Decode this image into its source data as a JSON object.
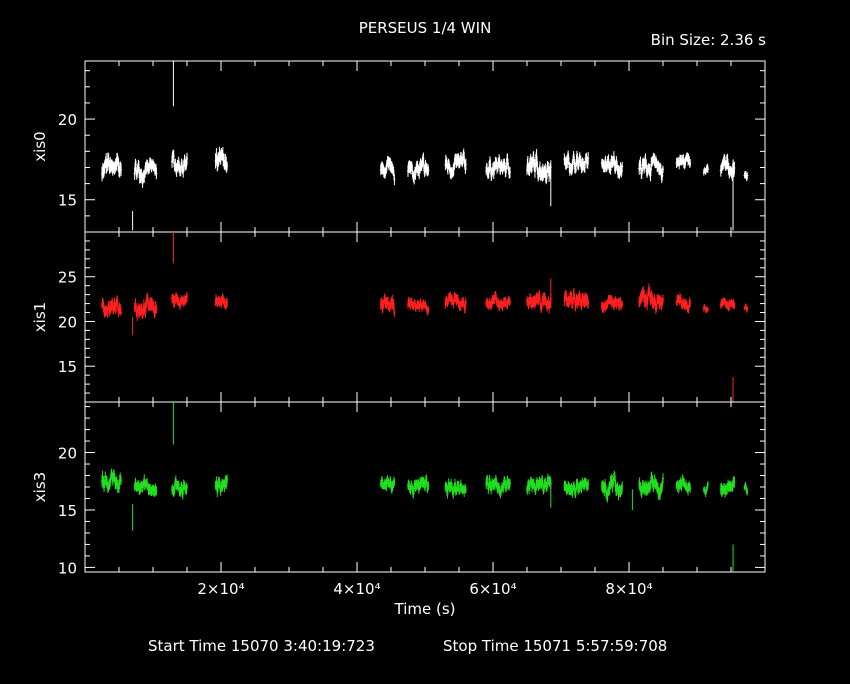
{
  "title": "PERSEUS 1/4 WIN",
  "bin_size_label": "Bin Size: 2.36 s",
  "xlabel": "Time (s)",
  "footer": {
    "start_label": "Start Time 15070  3:40:19:723",
    "stop_label": "Stop Time 15071  5:57:59:708"
  },
  "x_axis": {
    "range": [
      0,
      100000
    ],
    "ticks": [
      {
        "value": 20000,
        "label": "2×10⁴"
      },
      {
        "value": 40000,
        "label": "4×10⁴"
      },
      {
        "value": 60000,
        "label": "6×10⁴"
      },
      {
        "value": 80000,
        "label": "8×10⁴"
      }
    ],
    "minor_step": 5000
  },
  "chart_data": [
    {
      "type": "scatter",
      "name": "xis0",
      "ylabel": "xis0",
      "color": "#ffffff",
      "ylim": [
        13,
        23.6
      ],
      "yticks": [
        15,
        20
      ],
      "segments": [
        {
          "x0": 2500,
          "x1": 5300,
          "base": 16.9,
          "amp": 0.6
        },
        {
          "x0": 7300,
          "x1": 10500,
          "base": 16.8,
          "amp": 0.5
        },
        {
          "x0": 12800,
          "x1": 15000,
          "base": 17.2,
          "amp": 0.5
        },
        {
          "x0": 19200,
          "x1": 20900,
          "base": 17.2,
          "amp": 0.6
        },
        {
          "x0": 43500,
          "x1": 45500,
          "base": 16.7,
          "amp": 0.5
        },
        {
          "x0": 47500,
          "x1": 50500,
          "base": 16.8,
          "amp": 0.5
        },
        {
          "x0": 53000,
          "x1": 56000,
          "base": 17.1,
          "amp": 0.5
        },
        {
          "x0": 59000,
          "x1": 62500,
          "base": 17.0,
          "amp": 0.5
        },
        {
          "x0": 65000,
          "x1": 68500,
          "base": 17.0,
          "amp": 0.6
        },
        {
          "x0": 70500,
          "x1": 74000,
          "base": 17.3,
          "amp": 0.5
        },
        {
          "x0": 76000,
          "x1": 79000,
          "base": 17.1,
          "amp": 0.5
        },
        {
          "x0": 81500,
          "x1": 85000,
          "base": 17.0,
          "amp": 0.5
        },
        {
          "x0": 87000,
          "x1": 89000,
          "base": 17.3,
          "amp": 0.4
        },
        {
          "x0": 91000,
          "x1": 91600,
          "base": 16.8,
          "amp": 0.3
        },
        {
          "x0": 93500,
          "x1": 95500,
          "base": 17.0,
          "amp": 0.5
        },
        {
          "x0": 97000,
          "x1": 97400,
          "base": 16.6,
          "amp": 0.3
        }
      ],
      "spikes": [
        {
          "x": 13000,
          "y0": 20.8,
          "y1": 23.6
        },
        {
          "x": 7000,
          "y0": 13.1,
          "y1": 14.3
        },
        {
          "x": 95300,
          "y0": 13.1,
          "y1": 16.8
        },
        {
          "x": 68500,
          "y0": 14.6,
          "y1": 16.6
        }
      ]
    },
    {
      "type": "scatter",
      "name": "xis1",
      "ylabel": "xis1",
      "color": "#ff2020",
      "ylim": [
        11,
        30
      ],
      "yticks": [
        15,
        20,
        25
      ],
      "segments": [
        {
          "x0": 2500,
          "x1": 5300,
          "base": 21.5,
          "amp": 0.8
        },
        {
          "x0": 7300,
          "x1": 10500,
          "base": 21.8,
          "amp": 0.9
        },
        {
          "x0": 12800,
          "x1": 15000,
          "base": 22.3,
          "amp": 0.7
        },
        {
          "x0": 19200,
          "x1": 20900,
          "base": 22.2,
          "amp": 0.7
        },
        {
          "x0": 43500,
          "x1": 45500,
          "base": 21.6,
          "amp": 0.8
        },
        {
          "x0": 47500,
          "x1": 50500,
          "base": 21.8,
          "amp": 0.6
        },
        {
          "x0": 53000,
          "x1": 56000,
          "base": 22.1,
          "amp": 0.7
        },
        {
          "x0": 59000,
          "x1": 62500,
          "base": 22.1,
          "amp": 0.7
        },
        {
          "x0": 65000,
          "x1": 68500,
          "base": 22.2,
          "amp": 0.8
        },
        {
          "x0": 70500,
          "x1": 74000,
          "base": 22.6,
          "amp": 0.9
        },
        {
          "x0": 76000,
          "x1": 79000,
          "base": 21.9,
          "amp": 0.7
        },
        {
          "x0": 81500,
          "x1": 85000,
          "base": 22.3,
          "amp": 0.9
        },
        {
          "x0": 87000,
          "x1": 89000,
          "base": 22.4,
          "amp": 0.7
        },
        {
          "x0": 91000,
          "x1": 91600,
          "base": 21.6,
          "amp": 0.4
        },
        {
          "x0": 93500,
          "x1": 95500,
          "base": 21.7,
          "amp": 0.6
        },
        {
          "x0": 97000,
          "x1": 97400,
          "base": 21.3,
          "amp": 0.4
        }
      ],
      "spikes": [
        {
          "x": 13000,
          "y0": 26.5,
          "y1": 30
        },
        {
          "x": 7000,
          "y0": 18.5,
          "y1": 20.5
        },
        {
          "x": 95300,
          "y0": 11,
          "y1": 13.8
        },
        {
          "x": 68500,
          "y0": 21.5,
          "y1": 24.8
        }
      ]
    },
    {
      "type": "scatter",
      "name": "xis3",
      "ylabel": "xis3",
      "color": "#20e020",
      "ylim": [
        9.6,
        24.4
      ],
      "yticks": [
        10,
        15,
        20
      ],
      "segments": [
        {
          "x0": 2500,
          "x1": 5300,
          "base": 17.2,
          "amp": 0.7
        },
        {
          "x0": 7300,
          "x1": 10500,
          "base": 17.0,
          "amp": 0.6
        },
        {
          "x0": 12800,
          "x1": 15000,
          "base": 16.9,
          "amp": 0.6
        },
        {
          "x0": 19200,
          "x1": 20900,
          "base": 17.3,
          "amp": 0.7
        },
        {
          "x0": 43500,
          "x1": 45500,
          "base": 17.2,
          "amp": 0.6
        },
        {
          "x0": 47500,
          "x1": 50500,
          "base": 17.1,
          "amp": 0.6
        },
        {
          "x0": 53000,
          "x1": 56000,
          "base": 17.1,
          "amp": 0.6
        },
        {
          "x0": 59000,
          "x1": 62500,
          "base": 17.0,
          "amp": 0.6
        },
        {
          "x0": 65000,
          "x1": 68500,
          "base": 17.1,
          "amp": 0.6
        },
        {
          "x0": 70500,
          "x1": 74000,
          "base": 17.0,
          "amp": 0.6
        },
        {
          "x0": 76000,
          "x1": 79000,
          "base": 17.1,
          "amp": 0.7
        },
        {
          "x0": 81500,
          "x1": 85000,
          "base": 17.0,
          "amp": 0.7
        },
        {
          "x0": 87000,
          "x1": 89000,
          "base": 17.1,
          "amp": 0.6
        },
        {
          "x0": 91000,
          "x1": 91600,
          "base": 16.9,
          "amp": 0.4
        },
        {
          "x0": 93500,
          "x1": 95500,
          "base": 17.0,
          "amp": 0.6
        },
        {
          "x0": 97000,
          "x1": 97400,
          "base": 16.8,
          "amp": 0.4
        }
      ],
      "spikes": [
        {
          "x": 13000,
          "y0": 20.7,
          "y1": 24.4
        },
        {
          "x": 7000,
          "y0": 13.2,
          "y1": 15.5
        },
        {
          "x": 95300,
          "y0": 9.6,
          "y1": 12
        },
        {
          "x": 68500,
          "y0": 15.2,
          "y1": 17.5
        },
        {
          "x": 80500,
          "y0": 15.0,
          "y1": 16.8
        }
      ]
    }
  ]
}
